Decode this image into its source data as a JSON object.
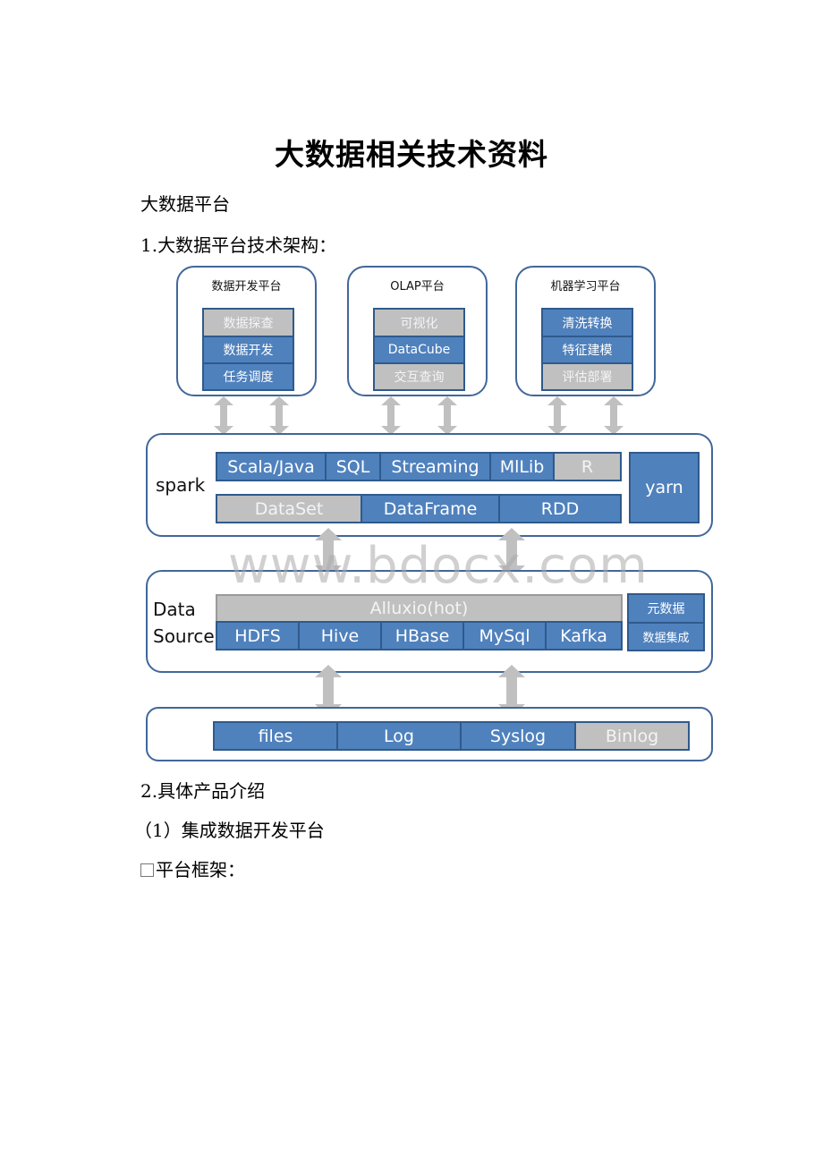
{
  "document": {
    "title": "大数据相关技术资料",
    "paragraphs": {
      "section": "大数据平台",
      "item1": "1.大数据平台技术架构：",
      "item2": "2.具体产品介绍",
      "item2_1": "（1）集成数据开发平台",
      "item2_1_a": "平台框架："
    }
  },
  "diagram": {
    "platforms": [
      {
        "title": "数据开发平台",
        "items": [
          {
            "label": "数据探查",
            "style": "gray"
          },
          {
            "label": "数据开发",
            "style": "blue"
          },
          {
            "label": "任务调度",
            "style": "blue"
          }
        ]
      },
      {
        "title": "OLAP平台",
        "items": [
          {
            "label": "可视化",
            "style": "gray"
          },
          {
            "label": "DataCube",
            "style": "blue"
          },
          {
            "label": "交互查询",
            "style": "gray"
          }
        ]
      },
      {
        "title": "机器学习平台",
        "items": [
          {
            "label": "清洗转换",
            "style": "blue"
          },
          {
            "label": "特征建模",
            "style": "blue"
          },
          {
            "label": "评估部署",
            "style": "gray"
          }
        ]
      }
    ],
    "spark": {
      "label": "spark",
      "row1": [
        {
          "label": "Scala/Java",
          "style": "blue"
        },
        {
          "label": "SQL",
          "style": "blue"
        },
        {
          "label": "Streaming",
          "style": "blue"
        },
        {
          "label": "MlLib",
          "style": "blue"
        },
        {
          "label": "R",
          "style": "gray"
        }
      ],
      "row2": [
        {
          "label": "DataSet",
          "style": "gray"
        },
        {
          "label": "DataFrame",
          "style": "blue"
        },
        {
          "label": "RDD",
          "style": "blue"
        }
      ],
      "side": "yarn"
    },
    "datasource": {
      "label_line1": "Data",
      "label_line2": "Source",
      "cache": "Alluxio(hot)",
      "stores": [
        {
          "label": "HDFS"
        },
        {
          "label": "Hive"
        },
        {
          "label": "HBase"
        },
        {
          "label": "MySql"
        },
        {
          "label": "Kafka"
        }
      ],
      "side": [
        {
          "label": "元数据"
        },
        {
          "label": "数据集成"
        }
      ]
    },
    "sources": [
      {
        "label": "files",
        "style": "blue"
      },
      {
        "label": "Log",
        "style": "blue"
      },
      {
        "label": "Syslog",
        "style": "blue"
      },
      {
        "label": "Binlog",
        "style": "gray"
      }
    ],
    "colors": {
      "blue": "#4f81bd",
      "gray": "#c0c0c0",
      "border": "#41679a"
    }
  },
  "watermark": "www.bdocx.com"
}
